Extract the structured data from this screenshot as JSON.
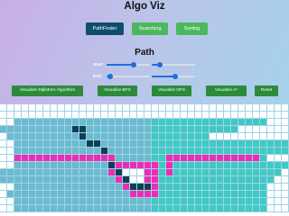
{
  "header": {
    "title": "Algo Viz"
  },
  "tabs": [
    {
      "label": "PathFinder",
      "active": true
    },
    {
      "label": "Searching",
      "active": false
    },
    {
      "label": "Sorting",
      "active": false
    }
  ],
  "path": {
    "title": "Path",
    "start_label": "Start:",
    "end_label": "End:",
    "start_sliders": [
      0.62,
      0.18
    ],
    "end_sliders": [
      0.08,
      0.55
    ]
  },
  "actions": {
    "dijkstra": "Visualize Dijkstra's Algorithm",
    "bfs": "Visualize BFS",
    "dfs": "Visualize DFS",
    "astar": "Visualize A*",
    "reset": "Reset"
  },
  "colors": {
    "accent": "#1e6fd9",
    "tab_active": "#0e4d6e",
    "tab_inactive": "#4cb85c",
    "action": "#2d8a3a",
    "visited": "#6bbad0",
    "visited_recent": "#40c9c4",
    "wall": "#0f3f52",
    "path": "#ee2bb5"
  },
  "grid": {
    "cols": 40,
    "rows": [
      "........................................",
      "........................................",
      "..vvvvvvvvvvvvvvvvvvvvvvvvvvvvvvvvvvv...",
      "vvvvvvvvvvwwvvvvvvvvvvvvvvvvvvvvv.......",
      ".vvvvvvvvvvwvvvvvvvvvvvvvvvvv...........",
      "..vvvvvvvvvvwwvvvvvvvvvvvvvvvvvvvvvvvvvv",
      "..vvvvvvvvvvvvwvvvvvvvvvvvvvvvvvvvvvvvvv",
      "..ppppppppppppppvvvvvvvpppppppppppppv...",
      "..vvvvvvvvvvvvvwppppppvpvvvvvvvvvvvvvvvv",
      "vvvvvvvvvvvvvvvpw...ppvpvvvvvvvvvvvvvvv.",
      "vvvvvvvvvvvvvvvvpw..ppvvvvvvvvvvvvvvvv..",
      "..vvvvvvvvvvvvvvvpwwwpvvvvvvvvvvvvvvv...",
      ".vvvvvvvvvvvvvvvvvppppvvvvvvvvvvvvvvv...",
      "..vvvvvvvvvvvvvvvvvvvvvvvvvvvvvvvvvvv...",
      "..vvvvvvvvvvvvvvvvvvvvvvvvvvvvvvvvvvv..."
    ]
  }
}
